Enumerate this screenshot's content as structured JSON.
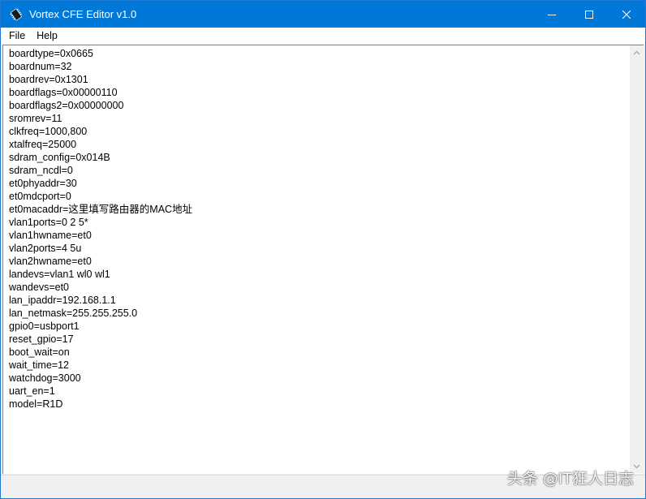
{
  "window": {
    "title": "Vortex CFE Editor v1.0",
    "accent_color": "#0078d7",
    "app_icon": "chip-icon"
  },
  "controls": {
    "minimize_icon": "minimize-icon",
    "maximize_icon": "maximize-icon",
    "close_icon": "close-icon"
  },
  "menu": {
    "items": [
      {
        "label": "File"
      },
      {
        "label": "Help"
      }
    ]
  },
  "editor": {
    "lines": [
      "boardtype=0x0665",
      "boardnum=32",
      "boardrev=0x1301",
      "boardflags=0x00000110",
      "boardflags2=0x00000000",
      "sromrev=11",
      "clkfreq=1000,800",
      "xtalfreq=25000",
      "sdram_config=0x014B",
      "sdram_ncdl=0",
      "et0phyaddr=30",
      "et0mdcport=0",
      "et0macaddr=这里填写路由器的MAC地址",
      "vlan1ports=0 2 5*",
      "vlan1hwname=et0",
      "vlan2ports=4 5u",
      "vlan2hwname=et0",
      "landevs=vlan1 wl0 wl1",
      "wandevs=et0",
      "lan_ipaddr=192.168.1.1",
      "lan_netmask=255.255.255.0",
      "gpio0=usbport1",
      "reset_gpio=17",
      "boot_wait=on",
      "wait_time=12",
      "watchdog=3000",
      "uart_en=1",
      "model=R1D"
    ]
  },
  "watermark": {
    "text": "头条 @IT狂人日志"
  }
}
